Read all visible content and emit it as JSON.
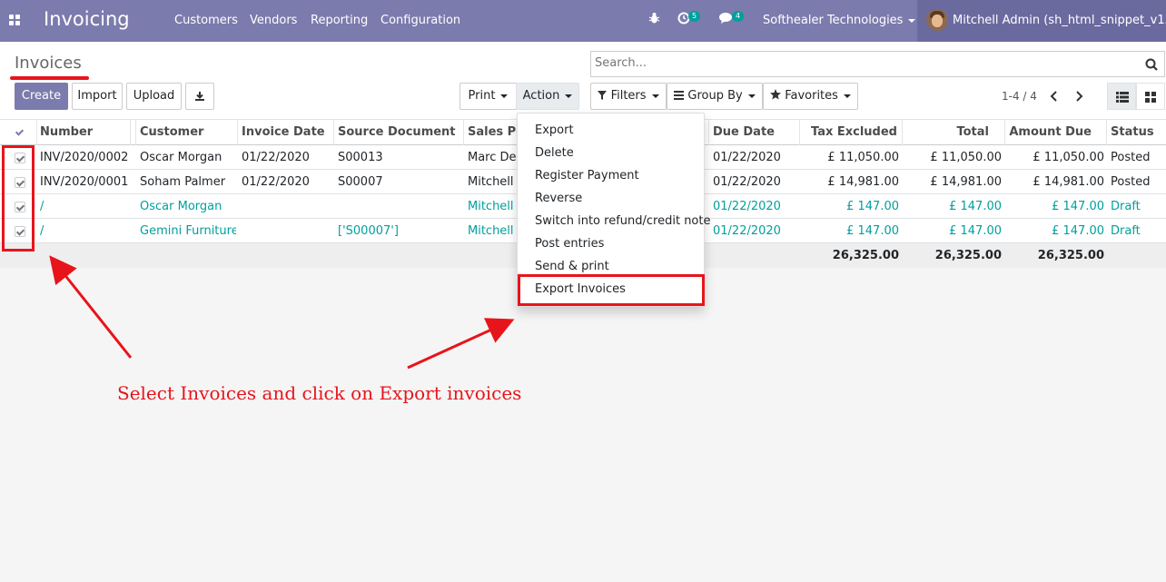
{
  "navbar": {
    "app_title": "Invoicing",
    "menu": [
      "Customers",
      "Vendors",
      "Reporting",
      "Configuration"
    ],
    "activity_badge": "5",
    "messages_badge": "4",
    "company": "Softhealer Technologies",
    "user": "Mitchell Admin (sh_html_snippet_v13)",
    "icons": [
      "apps-icon",
      "bug-icon",
      "clock-icon",
      "chat-icon",
      "user-avatar"
    ],
    "color": "#7c7bad"
  },
  "control": {
    "breadcrumb": "Invoices",
    "buttons": {
      "create": "Create",
      "import": "Import",
      "upload": "Upload"
    },
    "print": "Print",
    "action": "Action",
    "filters": "Filters",
    "group_by": "Group By",
    "favorites": "Favorites",
    "search_placeholder": "Search...",
    "pager": "1-4 / 4"
  },
  "table": {
    "headers": [
      "Number",
      "Customer",
      "Invoice Date",
      "Source Document",
      "Sales Pe",
      "Due Date",
      "Tax Excluded",
      "Total",
      "Amount Due",
      "Status"
    ],
    "rows": [
      {
        "number": "INV/2020/0002",
        "customer": "Oscar Morgan",
        "invoice_date": "01/22/2020",
        "source": "S00013",
        "sales": "Marc Der",
        "due": "01/22/2020",
        "tax_excl": "£ 11,050.00",
        "total": "£ 11,050.00",
        "due_amt": "£ 11,050.00",
        "status": "Posted"
      },
      {
        "number": "INV/2020/0001",
        "customer": "Soham Palmer",
        "invoice_date": "01/22/2020",
        "source": "S00007",
        "sales": "Mitchell A",
        "due": "01/22/2020",
        "tax_excl": "£ 14,981.00",
        "total": "£ 14,981.00",
        "due_amt": "£ 14,981.00",
        "status": "Posted"
      },
      {
        "number": "/",
        "customer": "Oscar Morgan",
        "invoice_date": "",
        "source": "",
        "sales": "Mitchell A",
        "due": "01/22/2020",
        "tax_excl": "£ 147.00",
        "total": "£ 147.00",
        "due_amt": "£ 147.00",
        "status": "Draft"
      },
      {
        "number": "/",
        "customer": "Gemini Furniture",
        "invoice_date": "",
        "source": "['S00007']",
        "sales": "Mitchell A",
        "due": "01/22/2020",
        "tax_excl": "£ 147.00",
        "total": "£ 147.00",
        "due_amt": "£ 147.00",
        "status": "Draft"
      }
    ],
    "totals": {
      "tax_excl": "26,325.00",
      "total": "26,325.00",
      "due_amt": "26,325.00"
    }
  },
  "action_menu": [
    "Export",
    "Delete",
    "Register Payment",
    "Reverse",
    "Switch into refund/credit note",
    "Post entries",
    "Send & print",
    "Export Invoices"
  ],
  "annotation": {
    "text": "Select Invoices and click on Export invoices",
    "color": "#e8141b"
  }
}
